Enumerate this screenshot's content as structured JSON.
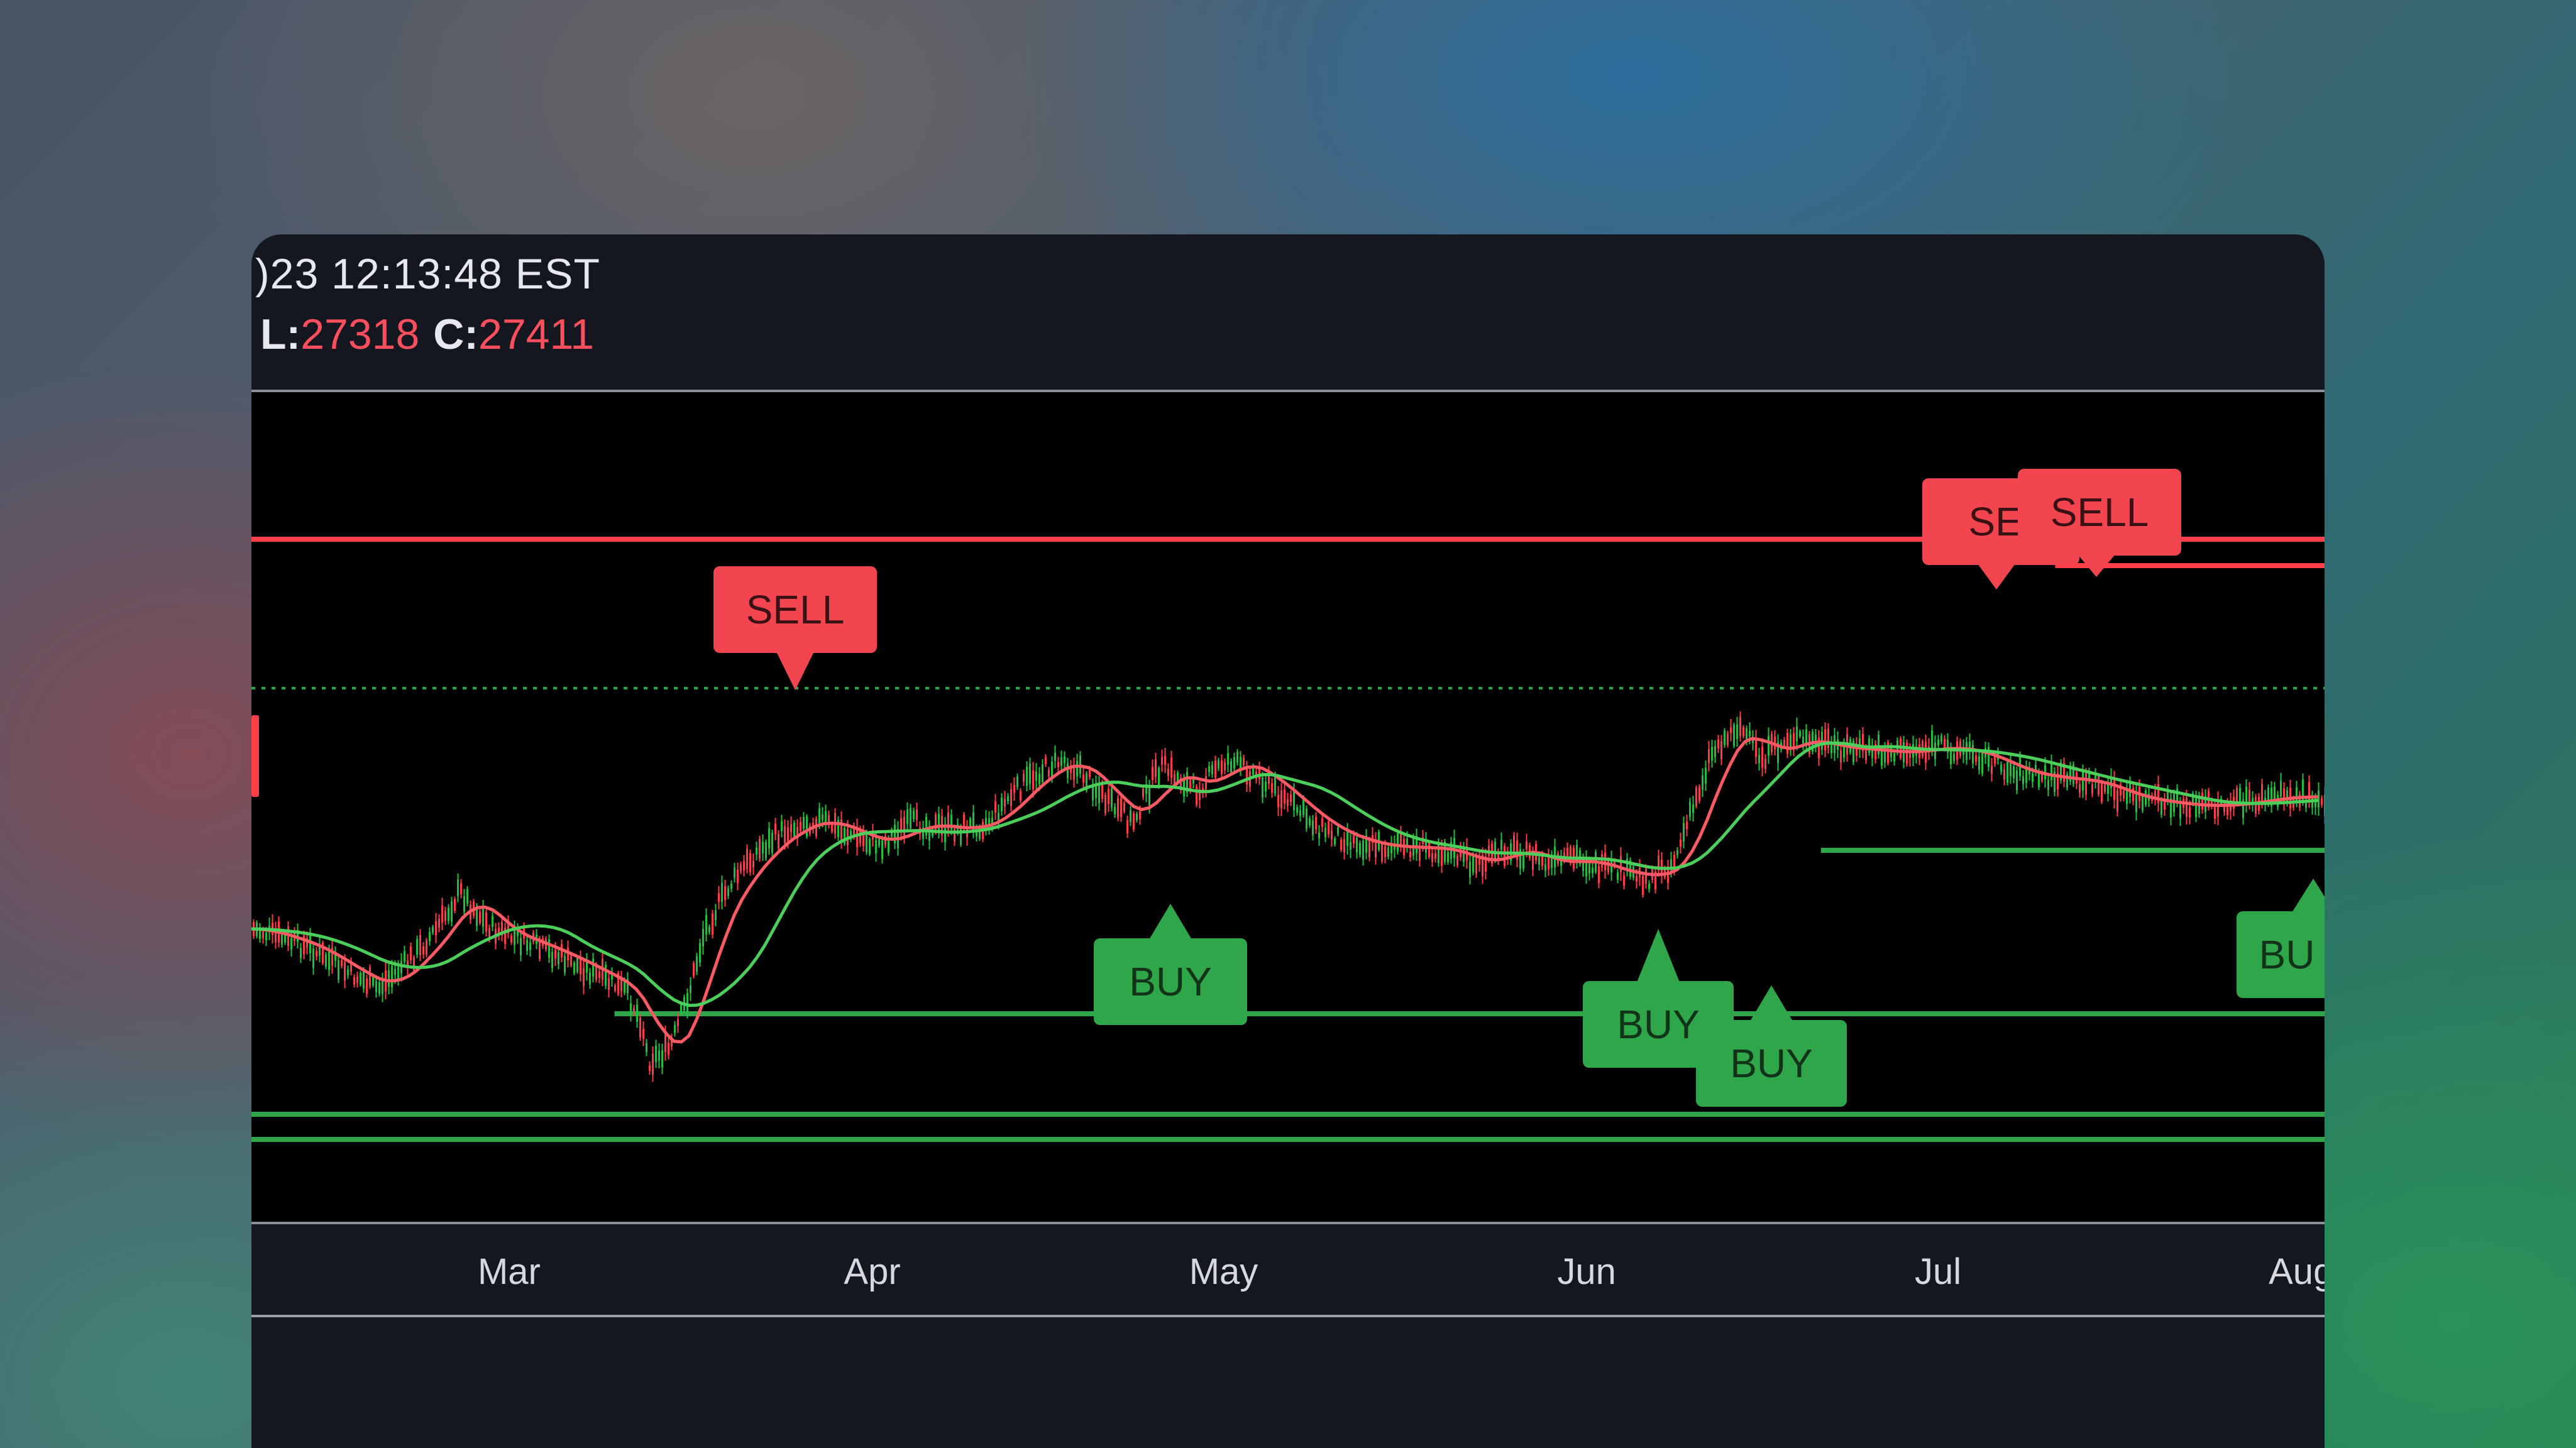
{
  "header": {
    "timestamp": ")23 12:13:48 EST",
    "low_label": "L:",
    "low_value": "27318",
    "close_label": "C:",
    "close_value": "27411"
  },
  "colors": {
    "up": "#22c03a",
    "down": "#ff3b45",
    "sell": "#f2454f",
    "buy": "#2fa64a",
    "ma_fast": "#ff5a64",
    "ma_slow": "#4ccf5a",
    "level": "#ff3f48",
    "support": "#2fa64a"
  },
  "chart_data": {
    "type": "line",
    "x_axis_ticks": [
      "Mar",
      "Apr",
      "May",
      "Jun",
      "Jul",
      "Aug"
    ],
    "x_range": [
      "2023-02-07",
      "2023-08-03"
    ],
    "y_axis_visible": false,
    "grid": false,
    "levels": [
      {
        "kind": "resistance",
        "color": "red",
        "style": "solid",
        "from": "2023-02-07"
      },
      {
        "kind": "resistance",
        "color": "red",
        "style": "solid",
        "from": "2023-07-11"
      },
      {
        "kind": "pivot",
        "color": "green",
        "style": "dotted",
        "from": "2023-02-07"
      },
      {
        "kind": "support",
        "color": "green",
        "style": "solid",
        "from": "2023-06-21"
      },
      {
        "kind": "support",
        "color": "green",
        "style": "solid",
        "from": "2023-03-10"
      },
      {
        "kind": "support",
        "color": "green",
        "style": "solid",
        "from": "2023-02-07"
      },
      {
        "kind": "support",
        "color": "green",
        "style": "solid",
        "from": "2023-02-07"
      }
    ],
    "signals": [
      {
        "label": "SELL",
        "date": "2023-03-24"
      },
      {
        "label": "BUY",
        "date": "2023-04-29"
      },
      {
        "label": "BUY",
        "date": "2023-06-08"
      },
      {
        "label": "BUY",
        "date": "2023-06-20"
      },
      {
        "label": "SEI",
        "date": "2023-07-04"
      },
      {
        "label": "SELL",
        "date": "2023-07-13"
      },
      {
        "label": "BU",
        "date": "2023-08-01"
      }
    ]
  }
}
